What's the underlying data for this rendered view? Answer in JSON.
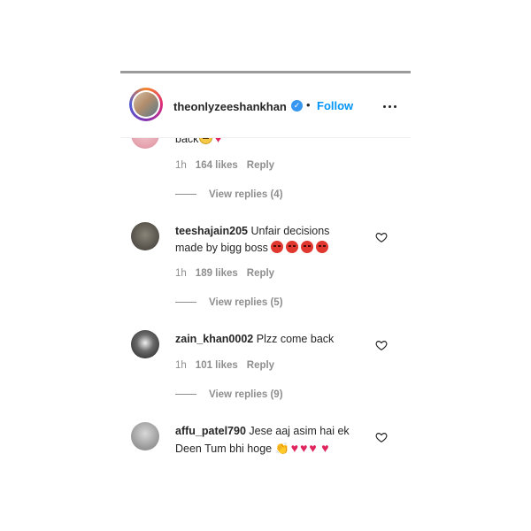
{
  "header": {
    "username": "theonlyzeeshankhan",
    "verified_glyph": "✓",
    "separator": "•",
    "follow_label": "Follow",
    "more_icon": "more-options-icon"
  },
  "comments": [
    {
      "username": "",
      "text": "back",
      "emoji": [
        "neutral-face",
        "red-heart"
      ],
      "time": "1h",
      "likes": "164 likes",
      "reply_label": "Reply",
      "view_replies": "View replies (4)"
    },
    {
      "username": "teeshajain205",
      "text": "Unfair decisions made by bigg boss",
      "emoji": [
        "angry-face",
        "angry-face",
        "angry-face",
        "angry-face"
      ],
      "time": "1h",
      "likes": "189 likes",
      "reply_label": "Reply",
      "view_replies": "View replies (5)"
    },
    {
      "username": "zain_khan0002",
      "text": "Plzz come back",
      "time": "1h",
      "likes": "101 likes",
      "reply_label": "Reply",
      "view_replies": "View replies (9)"
    },
    {
      "username": "affu_patel790",
      "text": "Jese aaj asim hai ek Deen Tum bhi hoge",
      "emoji": [
        "clapping-hands",
        "red-heart",
        "red-heart",
        "red-heart",
        "red-heart"
      ]
    }
  ],
  "colors": {
    "follow": "#0095f6",
    "verified": "#3897f0",
    "secondary_text": "#8e8e8e",
    "primary_text": "#262626"
  }
}
